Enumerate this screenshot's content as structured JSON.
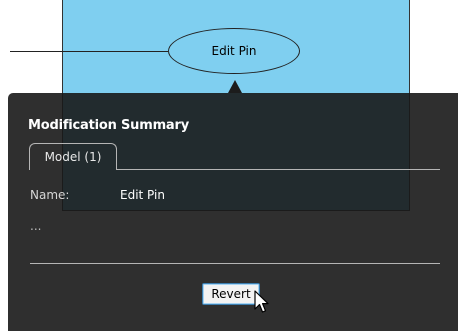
{
  "diagram": {
    "pin_label": "Edit Pin"
  },
  "panel": {
    "title": "Modification Summary",
    "tabs": [
      {
        "label": "Model (1)",
        "selected": true
      }
    ],
    "fields": [
      {
        "label": "Name:",
        "value": "Edit Pin"
      }
    ],
    "more": "...",
    "revert_label": "Revert"
  },
  "colors": {
    "node_fill": "#7fcff0",
    "panel_bg": "#181818",
    "button_border": "#3c7fb1"
  }
}
